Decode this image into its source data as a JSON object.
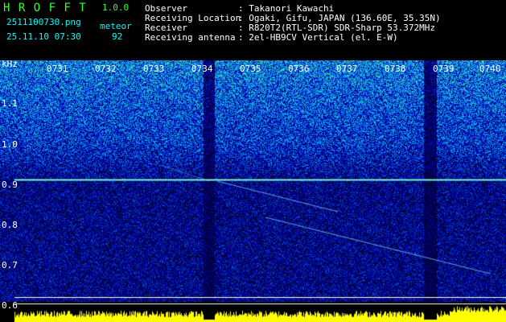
{
  "app": {
    "title": "H R O F F T",
    "version": "1.0.0",
    "filename": "2511100730.png",
    "datetime": "25.11.10 07:30",
    "mode_label": "meteor",
    "count": "92"
  },
  "info": {
    "observer_label": "Observer",
    "observer_value": ": Takanori Kawachi",
    "location_label": "Receiving Location",
    "location_value": ": Ogaki, Gifu, JAPAN (136.60E, 35.35N)",
    "receiver_label": "Receiver",
    "receiver_value": ": R820T2(RTL-SDR) SDR-Sharp 53.372MHz",
    "antenna_label": "Receiving antenna",
    "antenna_value": ": 2el-HB9CV Vertical (el. E-W)"
  },
  "axis": {
    "unit": "kHz",
    "y_ticks": [
      "1.1",
      "1.0",
      "0.9",
      "0.8",
      "0.7",
      "0.6"
    ],
    "time_ticks": [
      "0731",
      "0732",
      "0733",
      "0734",
      "0735",
      "0736",
      "0737",
      "0738",
      "0739",
      "0740"
    ]
  },
  "colors": {
    "background": "#000000",
    "header_green": "#33ff33",
    "header_cyan": "#00ffff",
    "carrier": "#ffffff",
    "level": "#ffff00"
  }
}
